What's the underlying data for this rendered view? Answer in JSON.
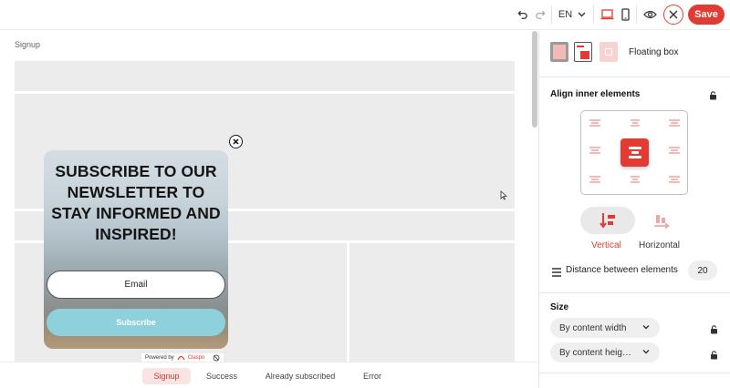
{
  "toolbar": {
    "language": "EN",
    "save_label": "Save"
  },
  "canvas": {
    "breadcrumb": "Signup",
    "popup": {
      "title": "SUBSCRIBE TO OUR NEWSLETTER TO STAY INFORMED AND INSPIRED!",
      "email_placeholder": "Email",
      "subscribe_label": "Subscribe",
      "powered_by": "Powered by",
      "brand": "Claspo"
    }
  },
  "bottom_tabs": [
    {
      "label": "Signup",
      "active": true
    },
    {
      "label": "Success",
      "active": false
    },
    {
      "label": "Already subscribed",
      "active": false
    },
    {
      "label": "Error",
      "active": false
    }
  ],
  "panel": {
    "layout_label": "Floating box",
    "align_title": "Align inner elements",
    "directions": {
      "vertical": "Vertical",
      "horizontal": "Horizontal",
      "selected": "vertical"
    },
    "distance_label": "Distance between elements",
    "distance_value": "20",
    "size_title": "Size",
    "width_option": "By content width",
    "height_option": "By content heig…"
  },
  "colors": {
    "accent": "#e23b34",
    "accent_light": "#f7e4e3",
    "subscribe_button": "#8ed1dd"
  }
}
